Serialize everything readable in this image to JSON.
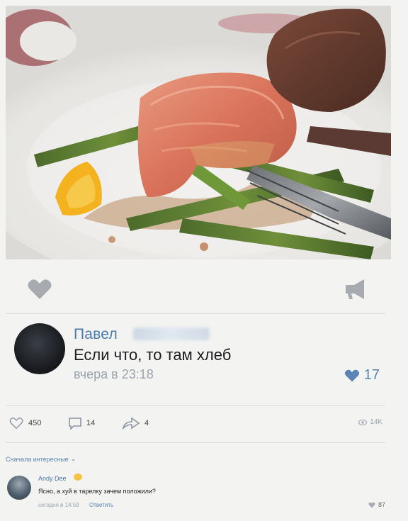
{
  "colors": {
    "accent": "#4a7ab0",
    "like_blue": "#5a84b6",
    "muted": "#9aa3ad",
    "background": "#f3f3f1"
  },
  "post": {
    "actions": {
      "like_icon": "heart-icon",
      "share_icon": "megaphone-icon"
    }
  },
  "comment": {
    "author_first_name": "Павел",
    "text": "Если что, то там хлеб",
    "time": "вчера в 23:18",
    "likes": "17"
  },
  "stats": {
    "likes": "450",
    "comments": "14",
    "shares": "4",
    "views": "14K"
  },
  "sort": {
    "label": "Сначала интересные"
  },
  "reply": {
    "author": "Andy Dee",
    "text": "Ясно, а хуй в тарелку зачем положили?",
    "time": "сегодня в 14:59",
    "action": "Ответить",
    "likes": "87"
  }
}
